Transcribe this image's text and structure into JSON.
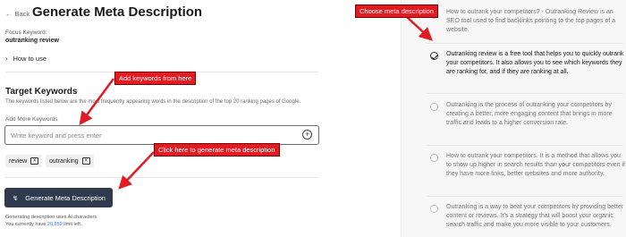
{
  "header": {
    "back_label": "Back",
    "title": "Generate Meta Description"
  },
  "focus": {
    "label": "Focus Keyword:",
    "value": "outranking review"
  },
  "how_to_use": "How to use",
  "target_keywords": {
    "title": "Target Keywords",
    "description": "The keywords listed below are the most frequently appearing words in the description of the top 20 ranking pages of Google.",
    "add_label": "Add More Keywords",
    "input_placeholder": "Write keyword and press enter",
    "tags": [
      "review",
      "outranking"
    ]
  },
  "generate": {
    "button_label": "Generate Meta Description",
    "note": "Generating description uses AI characters.",
    "limit_prefix": "You currently have",
    "limit_value": "20,859",
    "limit_suffix": "limit left."
  },
  "descriptions": [
    {
      "text": "How to outrank your competitors? - Outranking Review is an SEO tool used to find backlinks pointing to the top pages of a website.",
      "selected": false
    },
    {
      "text": "Outranking review is a free tool that helps you to quickly outrank your competitors. It also allows you to see which keywords they are ranking for, and if they are ranking at all.",
      "selected": true
    },
    {
      "text": "Outranking is the process of outranking your competitors by creating a better, more engaging content that brings in more traffic and leads to a higher conversion rate.",
      "selected": false
    },
    {
      "text": "How to outrank your competitors. It is a method that allows you to show up higher in search results than your competitors even if they have more links, better websites and more authority.",
      "selected": false
    },
    {
      "text": "Outranking is a way to beat your competitors by providing better content or reviews. It's a strategy that will boost your organic search traffic and make you more visible to your customers.",
      "selected": false
    }
  ],
  "annotations": {
    "choose": "Choose meta description",
    "add_keywords": "Add keywords from here",
    "click_here": "Click here to generate meta description"
  },
  "colors": {
    "callout": "#e21b23",
    "button": "#2f3a4f",
    "panel_bg": "#f7f7f7",
    "link": "#2b7ad8"
  }
}
